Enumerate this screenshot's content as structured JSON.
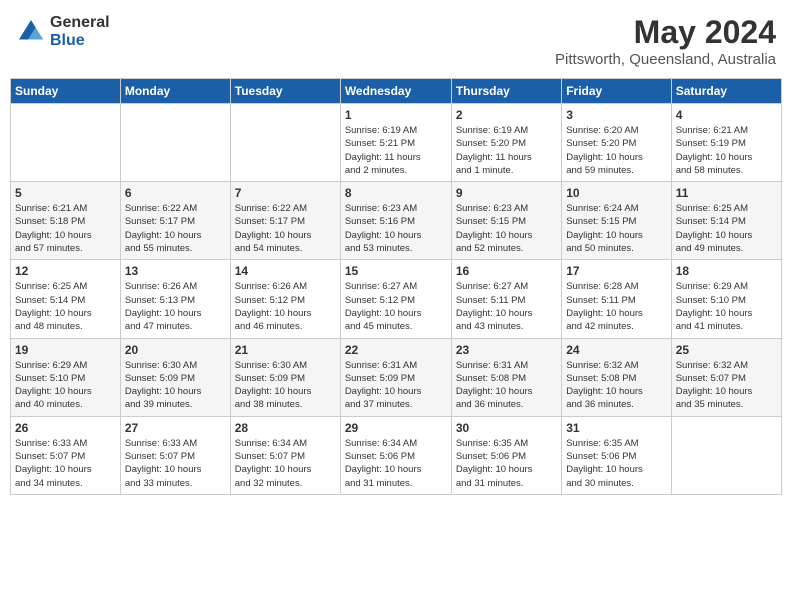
{
  "logo": {
    "general": "General",
    "blue": "Blue"
  },
  "title": "May 2024",
  "subtitle": "Pittsworth, Queensland, Australia",
  "days_header": [
    "Sunday",
    "Monday",
    "Tuesday",
    "Wednesday",
    "Thursday",
    "Friday",
    "Saturday"
  ],
  "weeks": [
    [
      {
        "day": "",
        "info": ""
      },
      {
        "day": "",
        "info": ""
      },
      {
        "day": "",
        "info": ""
      },
      {
        "day": "1",
        "info": "Sunrise: 6:19 AM\nSunset: 5:21 PM\nDaylight: 11 hours\nand 2 minutes."
      },
      {
        "day": "2",
        "info": "Sunrise: 6:19 AM\nSunset: 5:20 PM\nDaylight: 11 hours\nand 1 minute."
      },
      {
        "day": "3",
        "info": "Sunrise: 6:20 AM\nSunset: 5:20 PM\nDaylight: 10 hours\nand 59 minutes."
      },
      {
        "day": "4",
        "info": "Sunrise: 6:21 AM\nSunset: 5:19 PM\nDaylight: 10 hours\nand 58 minutes."
      }
    ],
    [
      {
        "day": "5",
        "info": "Sunrise: 6:21 AM\nSunset: 5:18 PM\nDaylight: 10 hours\nand 57 minutes."
      },
      {
        "day": "6",
        "info": "Sunrise: 6:22 AM\nSunset: 5:17 PM\nDaylight: 10 hours\nand 55 minutes."
      },
      {
        "day": "7",
        "info": "Sunrise: 6:22 AM\nSunset: 5:17 PM\nDaylight: 10 hours\nand 54 minutes."
      },
      {
        "day": "8",
        "info": "Sunrise: 6:23 AM\nSunset: 5:16 PM\nDaylight: 10 hours\nand 53 minutes."
      },
      {
        "day": "9",
        "info": "Sunrise: 6:23 AM\nSunset: 5:15 PM\nDaylight: 10 hours\nand 52 minutes."
      },
      {
        "day": "10",
        "info": "Sunrise: 6:24 AM\nSunset: 5:15 PM\nDaylight: 10 hours\nand 50 minutes."
      },
      {
        "day": "11",
        "info": "Sunrise: 6:25 AM\nSunset: 5:14 PM\nDaylight: 10 hours\nand 49 minutes."
      }
    ],
    [
      {
        "day": "12",
        "info": "Sunrise: 6:25 AM\nSunset: 5:14 PM\nDaylight: 10 hours\nand 48 minutes."
      },
      {
        "day": "13",
        "info": "Sunrise: 6:26 AM\nSunset: 5:13 PM\nDaylight: 10 hours\nand 47 minutes."
      },
      {
        "day": "14",
        "info": "Sunrise: 6:26 AM\nSunset: 5:12 PM\nDaylight: 10 hours\nand 46 minutes."
      },
      {
        "day": "15",
        "info": "Sunrise: 6:27 AM\nSunset: 5:12 PM\nDaylight: 10 hours\nand 45 minutes."
      },
      {
        "day": "16",
        "info": "Sunrise: 6:27 AM\nSunset: 5:11 PM\nDaylight: 10 hours\nand 43 minutes."
      },
      {
        "day": "17",
        "info": "Sunrise: 6:28 AM\nSunset: 5:11 PM\nDaylight: 10 hours\nand 42 minutes."
      },
      {
        "day": "18",
        "info": "Sunrise: 6:29 AM\nSunset: 5:10 PM\nDaylight: 10 hours\nand 41 minutes."
      }
    ],
    [
      {
        "day": "19",
        "info": "Sunrise: 6:29 AM\nSunset: 5:10 PM\nDaylight: 10 hours\nand 40 minutes."
      },
      {
        "day": "20",
        "info": "Sunrise: 6:30 AM\nSunset: 5:09 PM\nDaylight: 10 hours\nand 39 minutes."
      },
      {
        "day": "21",
        "info": "Sunrise: 6:30 AM\nSunset: 5:09 PM\nDaylight: 10 hours\nand 38 minutes."
      },
      {
        "day": "22",
        "info": "Sunrise: 6:31 AM\nSunset: 5:09 PM\nDaylight: 10 hours\nand 37 minutes."
      },
      {
        "day": "23",
        "info": "Sunrise: 6:31 AM\nSunset: 5:08 PM\nDaylight: 10 hours\nand 36 minutes."
      },
      {
        "day": "24",
        "info": "Sunrise: 6:32 AM\nSunset: 5:08 PM\nDaylight: 10 hours\nand 36 minutes."
      },
      {
        "day": "25",
        "info": "Sunrise: 6:32 AM\nSunset: 5:07 PM\nDaylight: 10 hours\nand 35 minutes."
      }
    ],
    [
      {
        "day": "26",
        "info": "Sunrise: 6:33 AM\nSunset: 5:07 PM\nDaylight: 10 hours\nand 34 minutes."
      },
      {
        "day": "27",
        "info": "Sunrise: 6:33 AM\nSunset: 5:07 PM\nDaylight: 10 hours\nand 33 minutes."
      },
      {
        "day": "28",
        "info": "Sunrise: 6:34 AM\nSunset: 5:07 PM\nDaylight: 10 hours\nand 32 minutes."
      },
      {
        "day": "29",
        "info": "Sunrise: 6:34 AM\nSunset: 5:06 PM\nDaylight: 10 hours\nand 31 minutes."
      },
      {
        "day": "30",
        "info": "Sunrise: 6:35 AM\nSunset: 5:06 PM\nDaylight: 10 hours\nand 31 minutes."
      },
      {
        "day": "31",
        "info": "Sunrise: 6:35 AM\nSunset: 5:06 PM\nDaylight: 10 hours\nand 30 minutes."
      },
      {
        "day": "",
        "info": ""
      }
    ]
  ]
}
